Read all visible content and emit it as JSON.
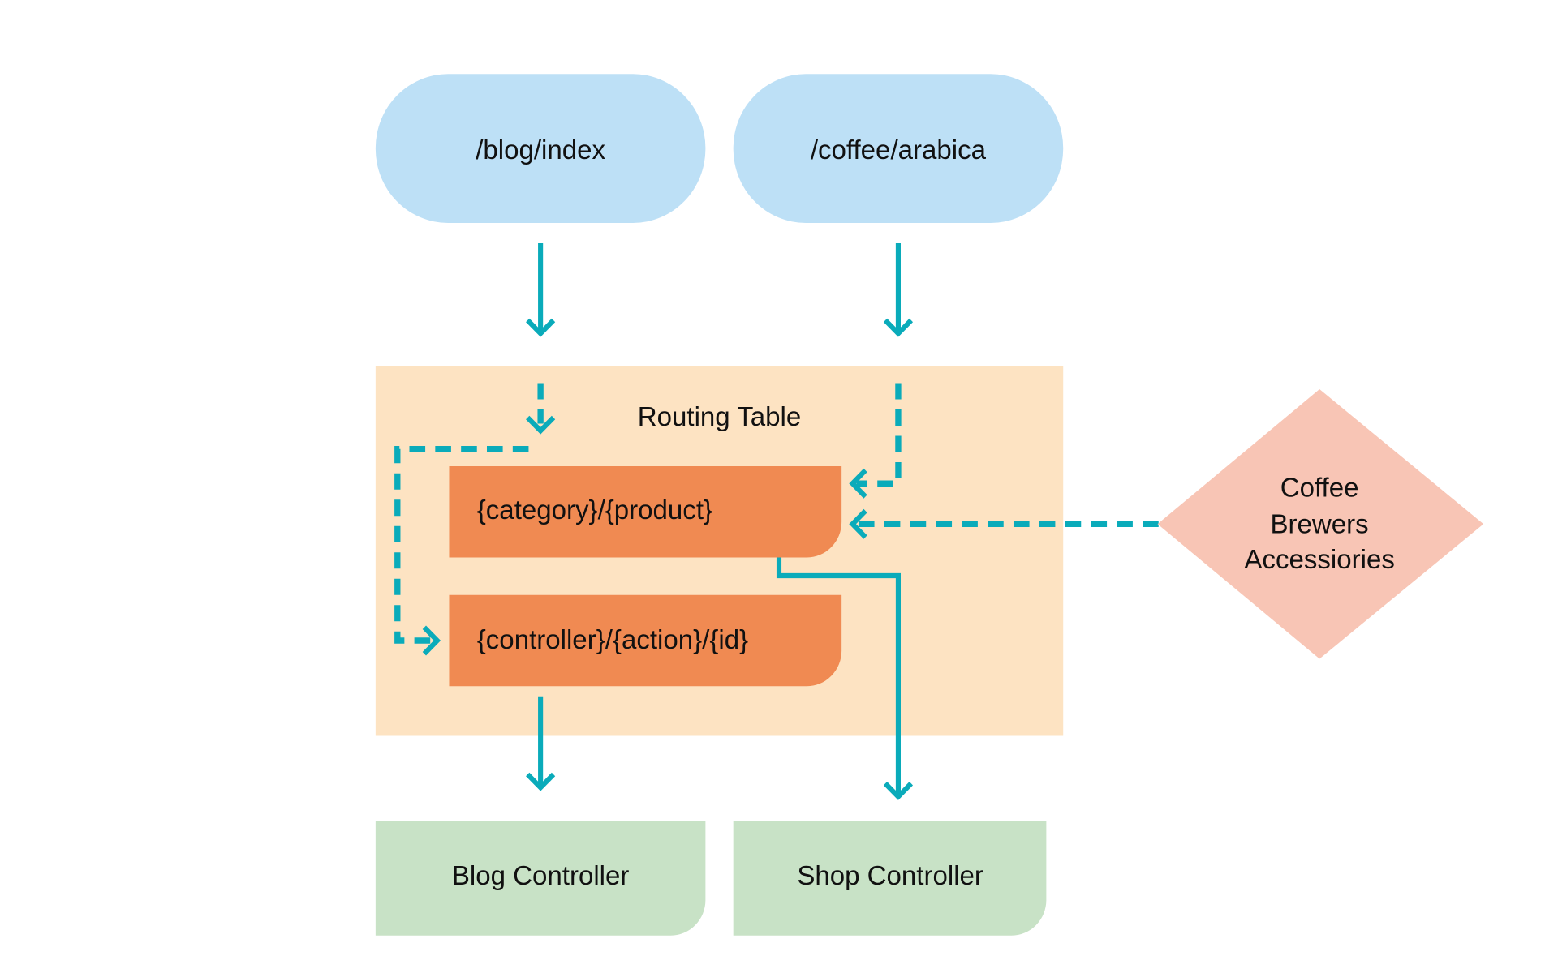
{
  "nodes": {
    "url_blog": "/blog/index",
    "url_coffee": "/coffee/arabica",
    "routing_table": "Routing Table",
    "route_category": "{category}/{product}",
    "route_controller": "{controller}/{action}/{id}",
    "blog_controller": "Blog Controller",
    "shop_controller": "Shop Controller",
    "categories": [
      "Coffee",
      "Brewers",
      "Accessiories"
    ]
  },
  "colors": {
    "url": "#bde0f6",
    "routing_table": "#fde3c2",
    "route": "#f08a52",
    "controller": "#c8e2c6",
    "categories": "#f8c5b5",
    "arrow": "#0aabba"
  }
}
